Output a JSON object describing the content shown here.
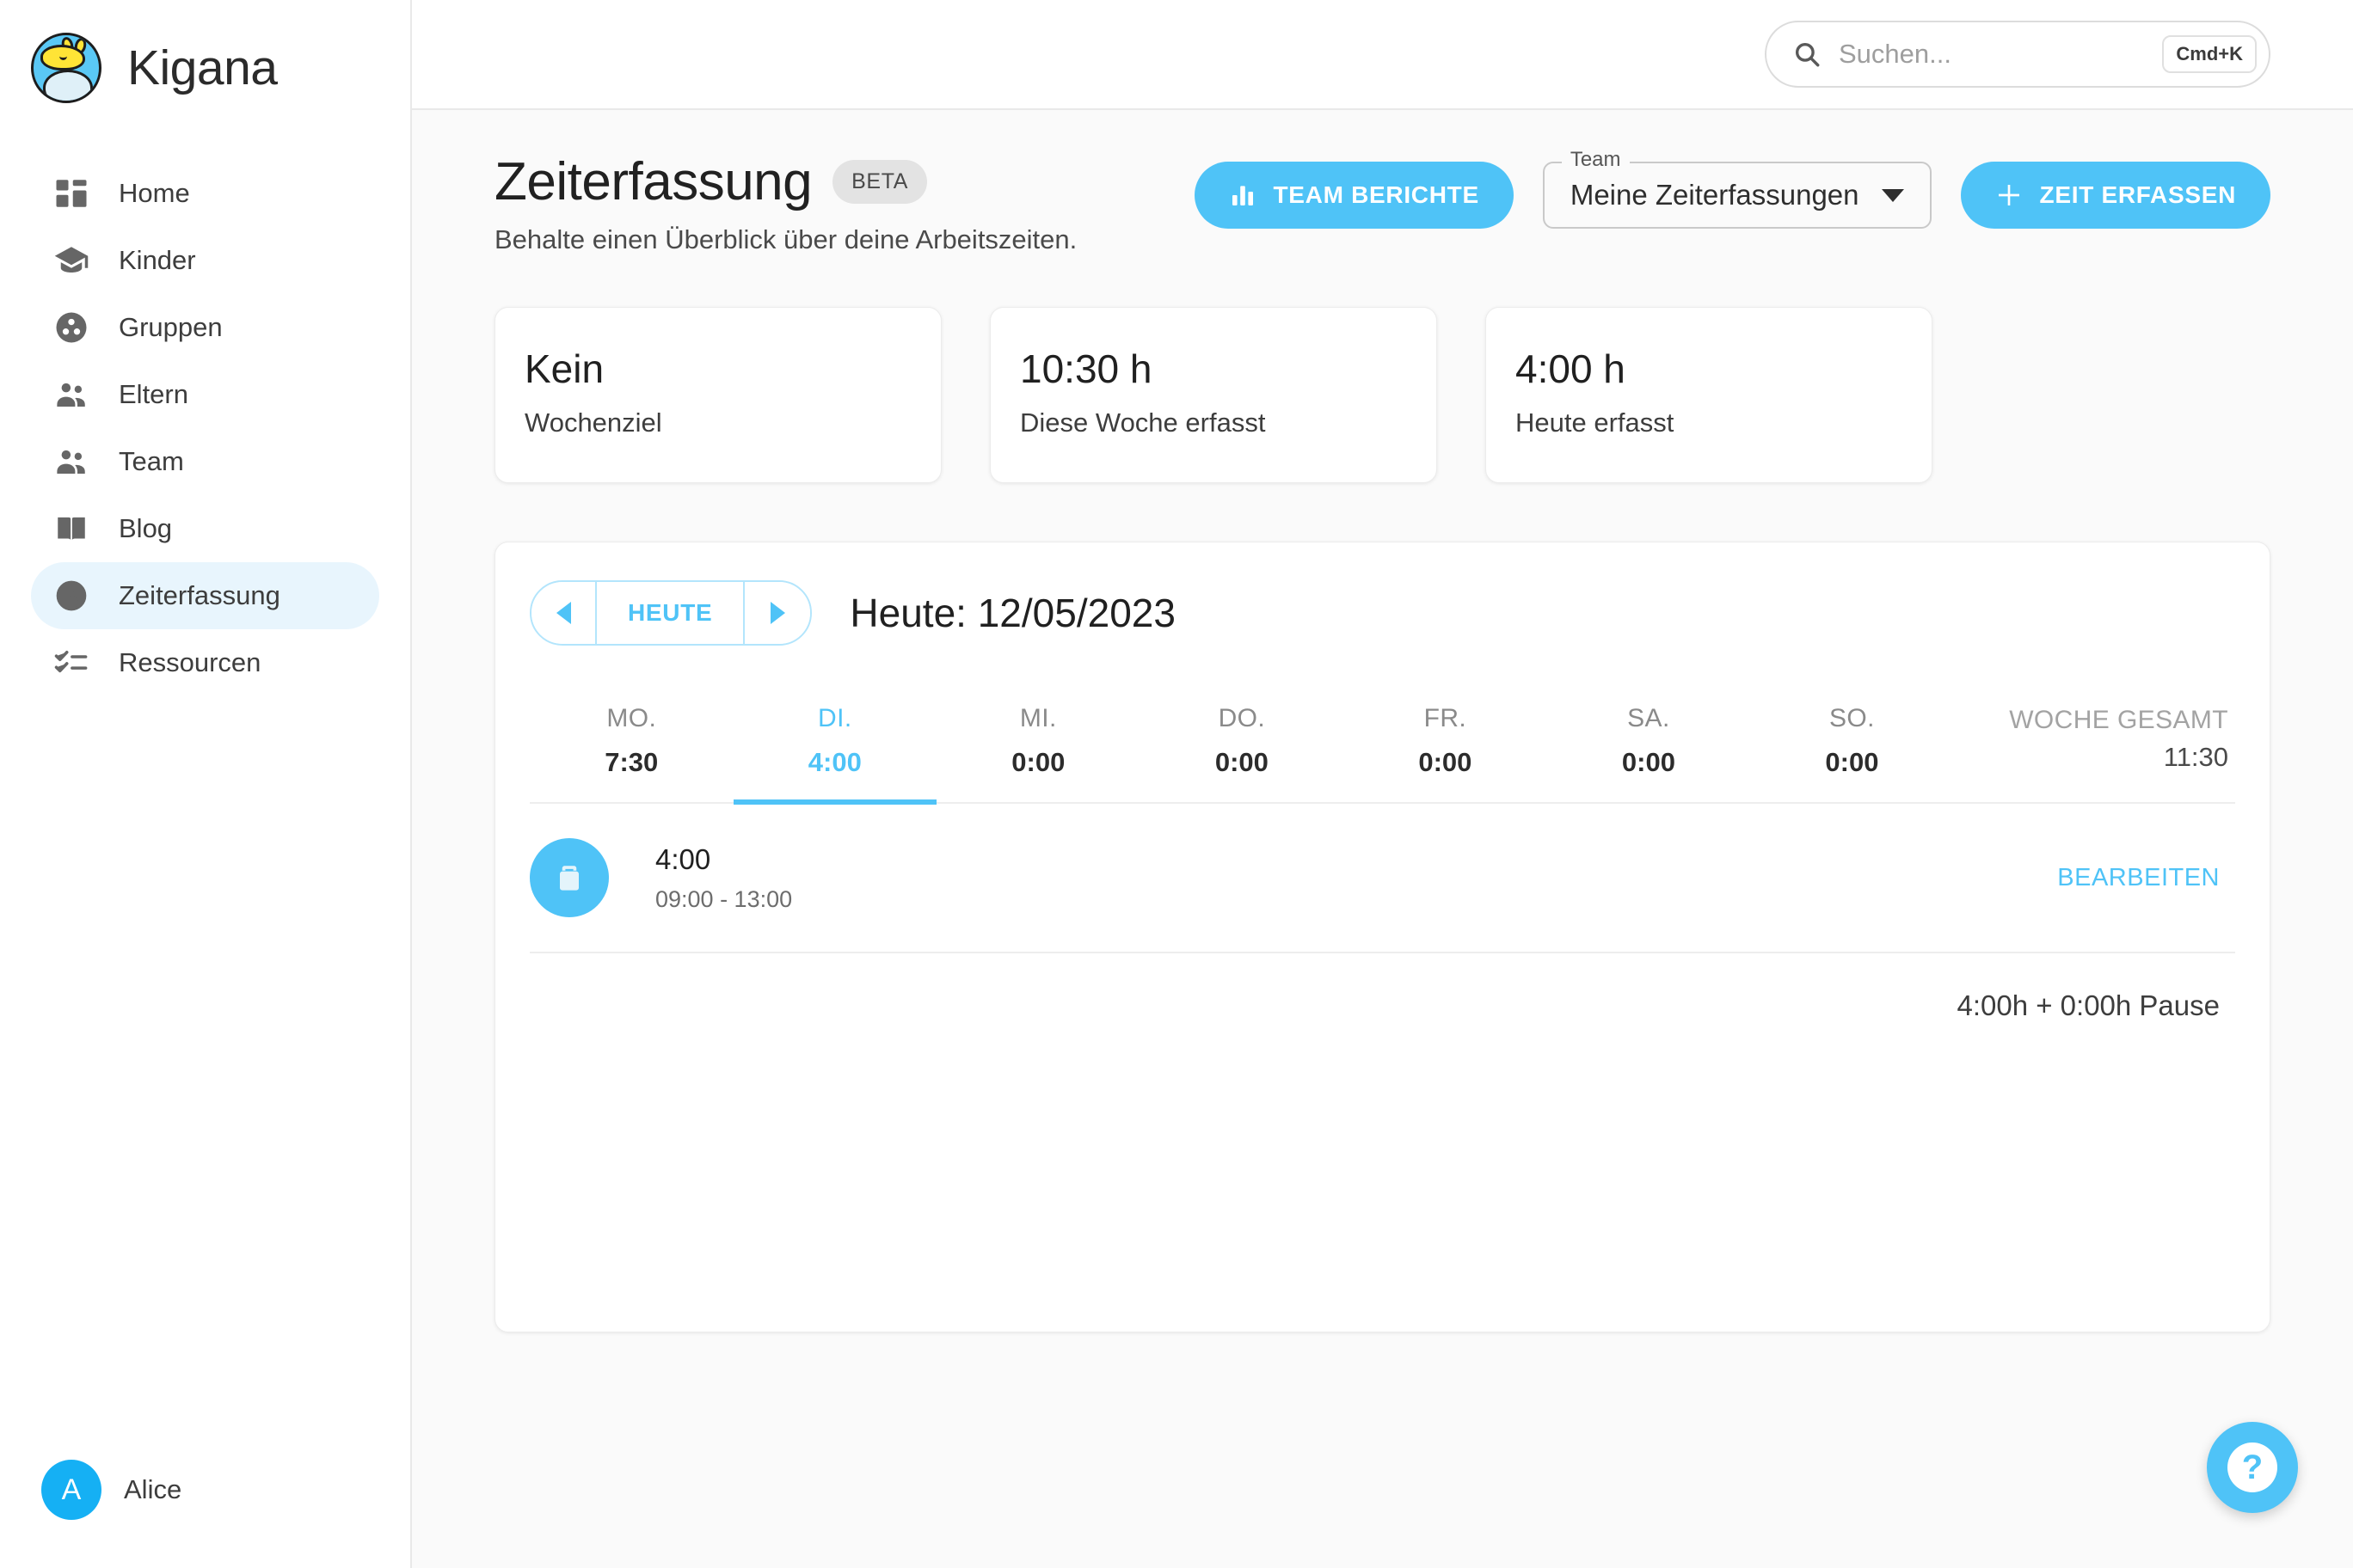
{
  "brand": {
    "name": "Kigana",
    "logo_icon": "giraffe-cloud-logo"
  },
  "sidebar": {
    "items": [
      {
        "label": "Home",
        "icon": "dashboard-icon",
        "active": false
      },
      {
        "label": "Kinder",
        "icon": "graduation-cap-icon",
        "active": false
      },
      {
        "label": "Gruppen",
        "icon": "group-circle-icon",
        "active": false
      },
      {
        "label": "Eltern",
        "icon": "people-icon",
        "active": false
      },
      {
        "label": "Team",
        "icon": "people-icon",
        "active": false
      },
      {
        "label": "Blog",
        "icon": "open-book-icon",
        "active": false
      },
      {
        "label": "Zeiterfassung",
        "icon": "clock-icon",
        "active": true
      },
      {
        "label": "Ressourcen",
        "icon": "checklist-icon",
        "active": false
      }
    ],
    "user": {
      "name": "Alice",
      "initial": "A"
    }
  },
  "topbar": {
    "search": {
      "placeholder": "Suchen...",
      "value": "",
      "shortcut": "Cmd+K",
      "icon": "search-icon"
    }
  },
  "page": {
    "title": "Zeiterfassung",
    "badge": "BETA",
    "subtitle": "Behalte einen Überblick über deine Arbeitszeiten."
  },
  "actions": {
    "team_reports_label": "TEAM BERICHTE",
    "team_reports_icon": "bar-chart-icon",
    "team_select_legend": "Team",
    "team_select_value": "Meine Zeiterfassungen",
    "record_time_label": "ZEIT ERFASSEN",
    "record_time_icon": "plus-icon"
  },
  "stats": [
    {
      "value": "Kein",
      "label": "Wochenziel"
    },
    {
      "value": "10:30 h",
      "label": "Diese Woche erfasst"
    },
    {
      "value": "4:00 h",
      "label": "Heute erfasst"
    }
  ],
  "date_nav": {
    "prev_icon": "chevron-left-icon",
    "today_label": "HEUTE",
    "next_icon": "chevron-right-icon",
    "current_label": "Heute: 12/05/2023"
  },
  "week": {
    "days": [
      {
        "name": "MO.",
        "value": "7:30",
        "active": false
      },
      {
        "name": "DI.",
        "value": "4:00",
        "active": true
      },
      {
        "name": "MI.",
        "value": "0:00",
        "active": false
      },
      {
        "name": "DO.",
        "value": "0:00",
        "active": false
      },
      {
        "name": "FR.",
        "value": "0:00",
        "active": false
      },
      {
        "name": "SA.",
        "value": "0:00",
        "active": false
      },
      {
        "name": "SO.",
        "value": "0:00",
        "active": false
      }
    ],
    "total_label": "WOCHE GESAMT",
    "total_value": "11:30"
  },
  "entries": [
    {
      "icon": "briefcase-icon",
      "duration": "4:00",
      "range": "09:00 - 13:00",
      "edit_label": "BEARBEITEN"
    }
  ],
  "entry_summary": "4:00h + 0:00h Pause",
  "help": {
    "icon": "question-mark-icon",
    "glyph": "?"
  },
  "colors": {
    "accent": "#4fc3f7",
    "accent_strong": "#15b0f4",
    "accent_soft": "#e8f5fd",
    "text": "#202020",
    "muted": "#8a8a8a",
    "page_bg": "#fafafa"
  }
}
